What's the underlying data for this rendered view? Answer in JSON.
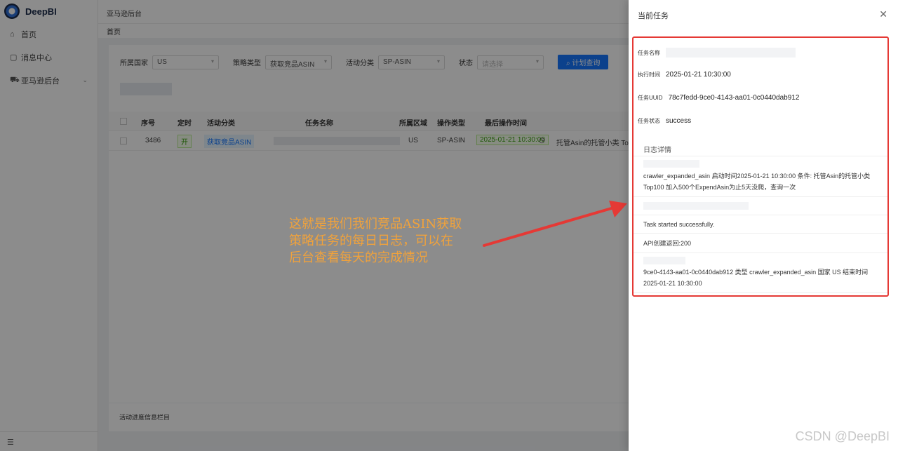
{
  "app": {
    "name": "DeepBI"
  },
  "sidebar": {
    "items": [
      {
        "label": "首页",
        "icon": "home-icon"
      },
      {
        "label": "消息中心",
        "icon": "message-icon"
      },
      {
        "label": "亚马逊后台",
        "icon": "cart-icon"
      }
    ],
    "collapse_label": "☰"
  },
  "header": {
    "breadcrumb": "亚马逊后台"
  },
  "tabs": [
    {
      "label": "首页"
    }
  ],
  "filters": {
    "country_label": "所属国家",
    "country_value": "US",
    "strategy_label": "策略类型",
    "strategy_value": "获取竞品ASIN",
    "category_label": "活动分类",
    "category_value": "SP-ASIN",
    "status_label": "状态",
    "status_placeholder": "请选择",
    "search_button": "计划查询"
  },
  "table": {
    "columns": [
      "序号",
      "定时",
      "活动分类",
      "任务名称",
      "所属区域",
      "操作类型",
      "最后操作时间"
    ],
    "rows": [
      {
        "id": "3486",
        "timer": "开",
        "category": "获取竞品ASIN",
        "region": "US",
        "op_type": "SP-ASIN",
        "last_time": "2025-01-21 10:30:00",
        "desc": "托管Asin的托管小类 Top"
      }
    ]
  },
  "bottom": {
    "title": "活动进度信息栏目"
  },
  "annotation": {
    "text_lines": [
      "这就是我们我们竞品ASIN获取",
      "策略任务的每日日志，可以在",
      "后台查看每天的完成情况"
    ]
  },
  "drawer": {
    "title": "当前任务",
    "fields": {
      "name_label": "任务名称",
      "time_label": "执行时间",
      "time_value": "2025-01-21 10:30:00",
      "uuid_label": "任务UUID",
      "uuid_value": "78c7fedd-9ce0-4143-aa01-0c0440dab912",
      "status_label": "任务状态",
      "status_value": "success"
    },
    "log_title": "日志详情",
    "logs": [
      "crawler_expanded_asin 启动时间2025-01-21 10:30:00 条件: 托管Asin的托管小类Top100 加入500个ExpendAsin为止5天没爬，查询一次",
      "Task started successfully.",
      "API创建返回:200",
      "9ce0-4143-aa01-0c0440dab912 类型 crawler_expanded_asin 国家 US 结束时间 2025-01-21 10:30:00"
    ]
  },
  "watermark": "CSDN @DeepBI",
  "colors": {
    "accent": "#1677ff",
    "highlight": "#e53935",
    "annotation": "#f0a23c"
  }
}
